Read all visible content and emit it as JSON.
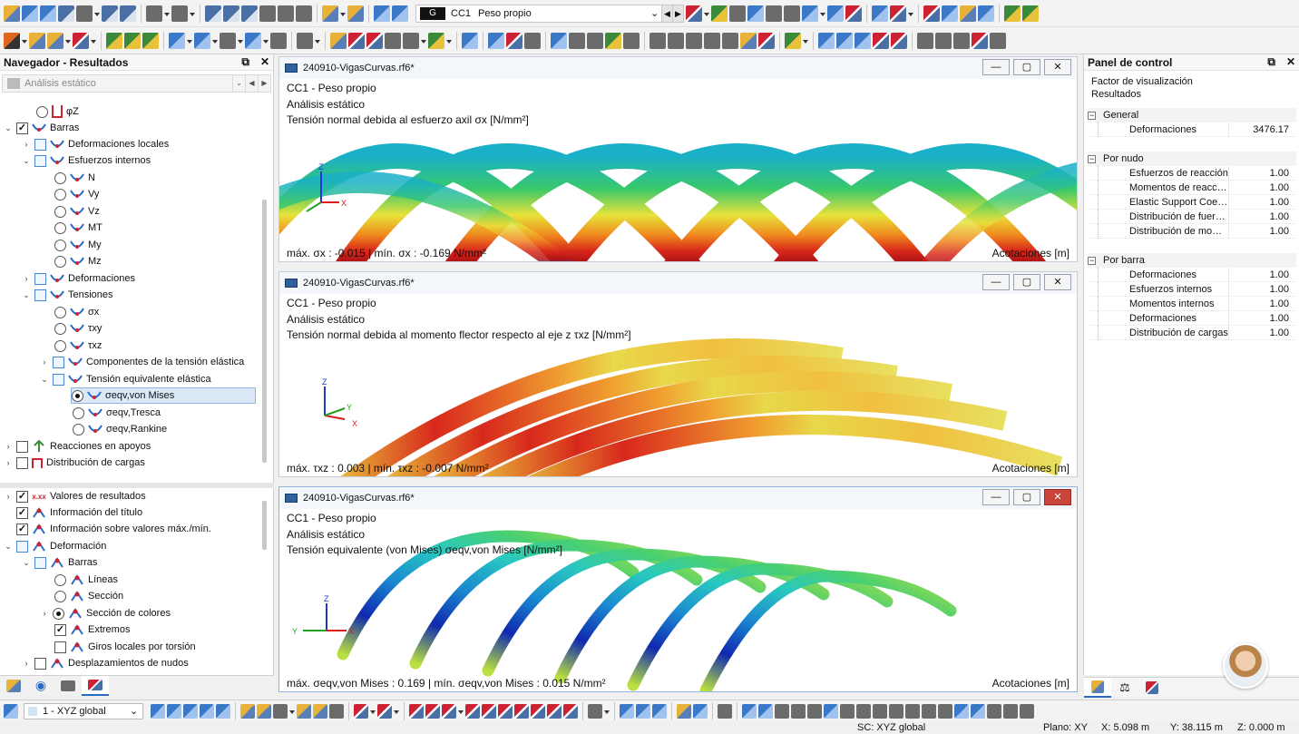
{
  "toolbar": {
    "load_case": {
      "badge": "G",
      "id": "CC1",
      "name": "Peso propio"
    }
  },
  "navigator": {
    "title": "Navegador - Resultados",
    "analysis": "Análisis estático",
    "items": [
      {
        "label": "φZ"
      },
      {
        "label": "Barras"
      },
      {
        "label": "Deformaciones locales"
      },
      {
        "label": "Esfuerzos internos"
      },
      {
        "label": "N"
      },
      {
        "label": "Vy"
      },
      {
        "label": "Vz"
      },
      {
        "label": "MT"
      },
      {
        "label": "My"
      },
      {
        "label": "Mz"
      },
      {
        "label": "Deformaciones"
      },
      {
        "label": "Tensiones"
      },
      {
        "label": "σx"
      },
      {
        "label": "τxy"
      },
      {
        "label": "τxz"
      },
      {
        "label": "Componentes de la tensión elástica"
      },
      {
        "label": "Tensión equivalente elástica"
      },
      {
        "label": "σeqv,von Mises"
      },
      {
        "label": "σeqv,Tresca"
      },
      {
        "label": "σeqv,Rankine"
      },
      {
        "label": "Reacciones en apoyos"
      },
      {
        "label": "Distribución de cargas"
      }
    ],
    "items2": [
      {
        "label": "Valores de resultados"
      },
      {
        "label": "Información del título"
      },
      {
        "label": "Información sobre valores máx./mín."
      },
      {
        "label": "Deformación"
      },
      {
        "label": "Barras"
      },
      {
        "label": "Líneas"
      },
      {
        "label": "Sección"
      },
      {
        "label": "Sección de colores"
      },
      {
        "label": "Extremos"
      },
      {
        "label": "Giros locales por torsión"
      },
      {
        "label": "Desplazamientos de nudos"
      }
    ]
  },
  "views": [
    {
      "title": "240910-VigasCurvas.rf6*",
      "lc": "CC1 - Peso propio",
      "analysis": "Análisis estático",
      "desc": "Tensión normal debida al esfuerzo axil σx [N/mm²]",
      "minmax": "máx. σx : -0.015 | mín. σx : -0.169 N/mm²",
      "dims": "Acotaciones [m]"
    },
    {
      "title": "240910-VigasCurvas.rf6*",
      "lc": "CC1 - Peso propio",
      "analysis": "Análisis estático",
      "desc": "Tensión normal debida al momento flector respecto al eje z τxz [N/mm²]",
      "minmax": "máx. τxz : 0.003 | mín. τxz : -0.007 N/mm²",
      "dims": "Acotaciones [m]"
    },
    {
      "title": "240910-VigasCurvas.rf6*",
      "lc": "CC1 - Peso propio",
      "analysis": "Análisis estático",
      "desc": "Tensión equivalente (von Mises) σeqv,von Mises [N/mm²]",
      "minmax": "máx. σeqv,von Mises : 0.169 | mín. σeqv,von Mises : 0.015 N/mm²",
      "dims": "Acotaciones [m]"
    }
  ],
  "control_panel": {
    "title": "Panel de control",
    "line1": "Factor de visualización",
    "line2": "Resultados",
    "general": {
      "title": "General",
      "rows": [
        {
          "label": "Deformaciones",
          "value": "3476.17"
        }
      ]
    },
    "per_node": {
      "title": "Por nudo",
      "rows": [
        {
          "label": "Esfuerzos de reacción",
          "value": "1.00"
        },
        {
          "label": "Momentos de reacción",
          "value": "1.00"
        },
        {
          "label": "Elastic Support Coeffici...",
          "value": "1.00"
        },
        {
          "label": "Distribución de fuerzas",
          "value": "1.00"
        },
        {
          "label": "Distribución de mome...",
          "value": "1.00"
        }
      ]
    },
    "per_member": {
      "title": "Por barra",
      "rows": [
        {
          "label": "Deformaciones",
          "value": "1.00"
        },
        {
          "label": "Esfuerzos internos",
          "value": "1.00"
        },
        {
          "label": "Momentos internos",
          "value": "1.00"
        },
        {
          "label": "Deformaciones",
          "value": "1.00"
        },
        {
          "label": "Distribución de cargas",
          "value": "1.00"
        }
      ]
    }
  },
  "bottom": {
    "coord_system": "1 - XYZ global"
  },
  "status": {
    "sc": "SC: XYZ global",
    "plane": "Plano: XY",
    "x": "X: 5.098 m",
    "y": "Y: 38.115 m",
    "z": "Z: 0.000 m"
  }
}
